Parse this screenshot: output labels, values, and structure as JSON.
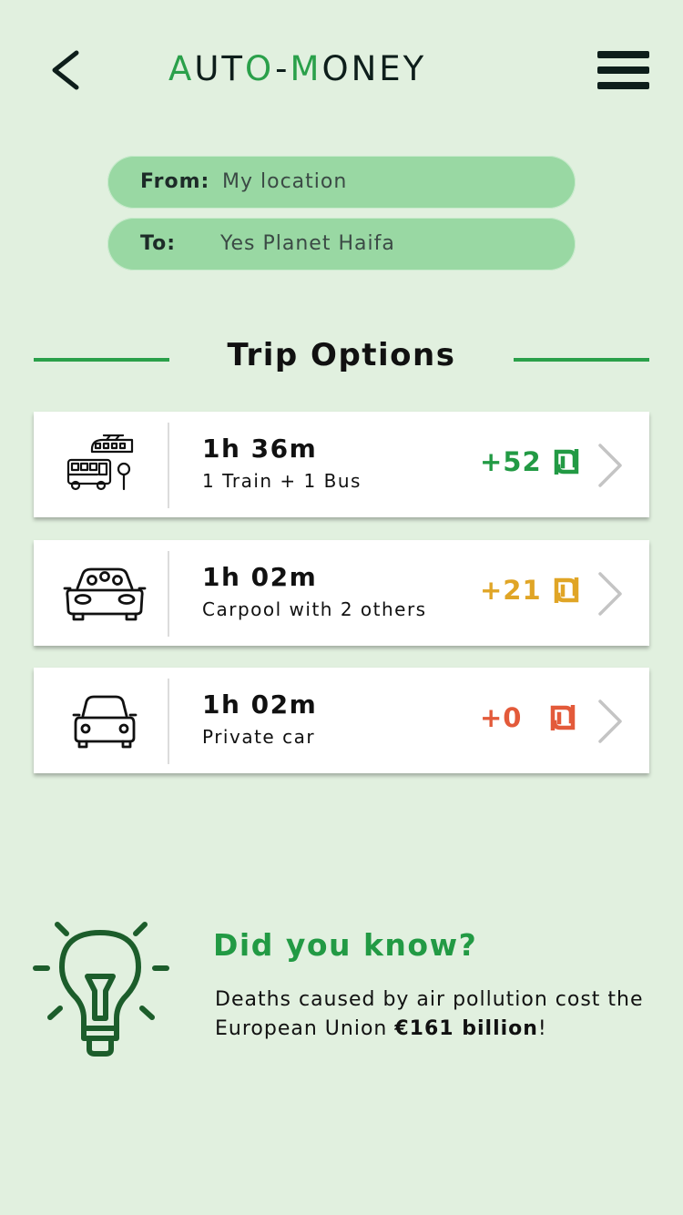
{
  "header": {
    "logo_parts": [
      {
        "text": "A",
        "color": "green"
      },
      {
        "text": "UT",
        "color": "dark"
      },
      {
        "text": "O",
        "color": "green"
      },
      {
        "text": "-",
        "color": "dark"
      },
      {
        "text": "M",
        "color": "green"
      },
      {
        "text": "ONEY",
        "color": "dark"
      }
    ],
    "back_icon": "chevron-left-icon",
    "menu_icon": "hamburger-menu-icon"
  },
  "route": {
    "from_label": "From:",
    "from_value": "My location",
    "to_label": "To:",
    "to_value": "Yes Planet Haifa"
  },
  "trip_options": {
    "title": "Trip Options",
    "items": [
      {
        "icon": "train-bus-icon",
        "duration": "1h 36m",
        "description": "1 Train + 1 Bus",
        "reward": "+52",
        "reward_color": "#229a44"
      },
      {
        "icon": "carpool-car-icon",
        "duration": "1h 02m",
        "description": "Carpool with 2 others",
        "reward": "+21",
        "reward_color": "#e0a526"
      },
      {
        "icon": "car-icon",
        "duration": "1h 02m",
        "description": "Private car",
        "reward": "+0",
        "reward_color": "#e35a3a"
      }
    ]
  },
  "tip": {
    "icon": "lightbulb-icon",
    "title": "Did you know?",
    "text_before": "Deaths caused by air pollution cost the European Union ",
    "text_bold": "€161 billion",
    "text_after": "!"
  },
  "colors": {
    "background": "#e1f0df",
    "accent_green": "#2aa04a",
    "field_green": "#99d8a3",
    "dark": "#0e1e1b"
  }
}
